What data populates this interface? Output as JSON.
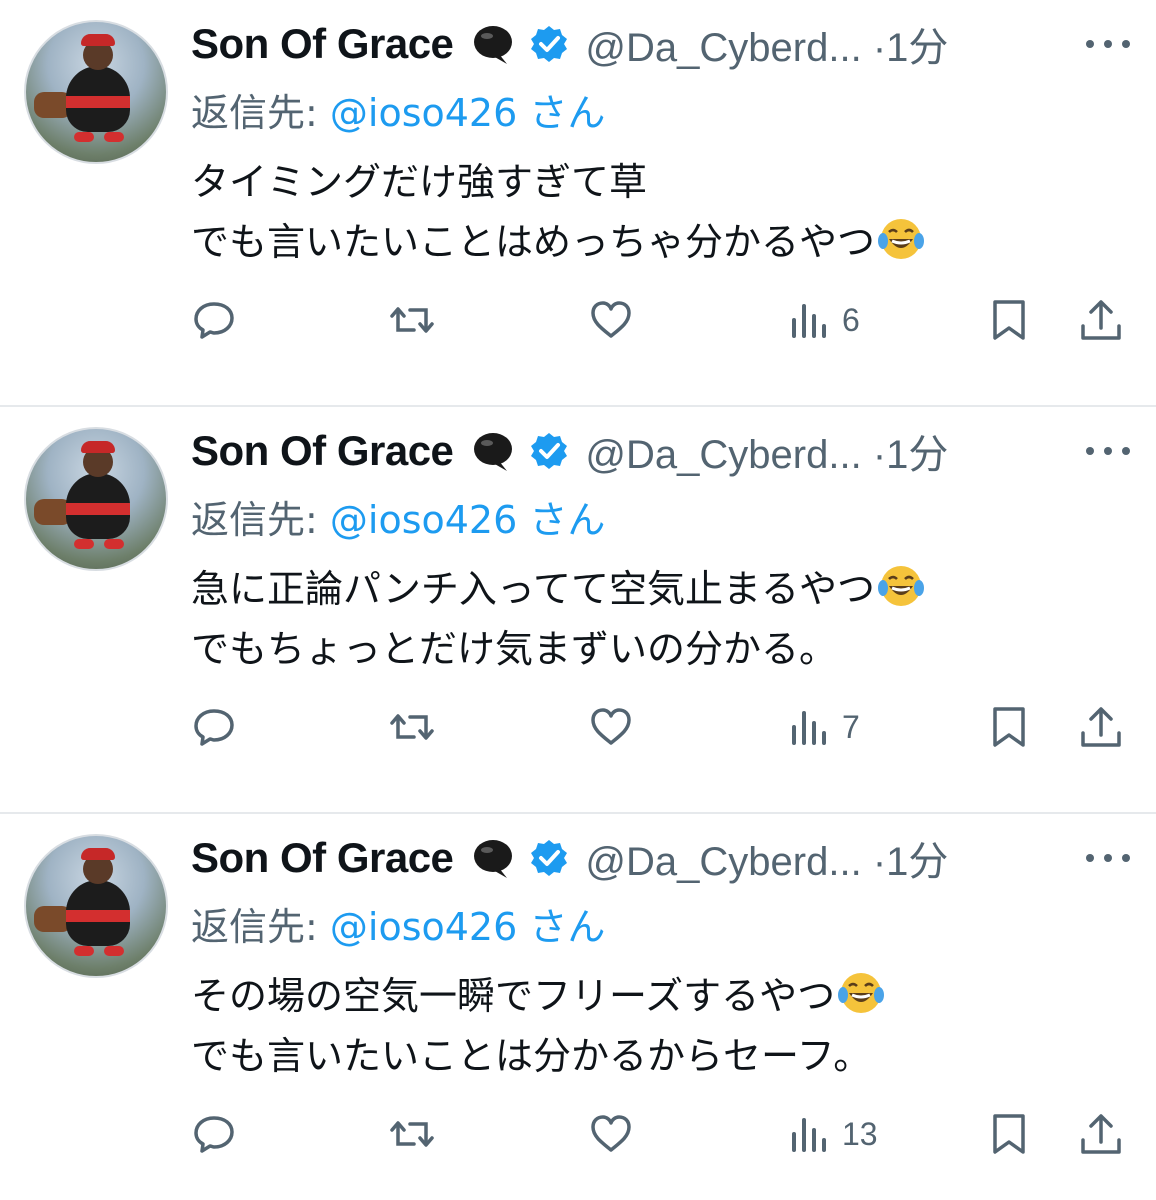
{
  "tweets": [
    {
      "author": "Son Of Grace",
      "handle": "@Da_Cyberd...",
      "time": "1分",
      "reply_label": "返信先:",
      "reply_to": "@ioso426 さん",
      "lines": [
        "タイミングだけ強すぎて草",
        "でも言いたいことはめっちゃ分かるやつ"
      ],
      "emoji_line": 1,
      "views": "6"
    },
    {
      "author": "Son Of Grace",
      "handle": "@Da_Cyberd...",
      "time": "1分",
      "reply_label": "返信先:",
      "reply_to": "@ioso426 さん",
      "lines": [
        "急に正論パンチ入ってて空気止まるやつ",
        "でもちょっとだけ気まずいの分かる。"
      ],
      "emoji_line": 0,
      "views": "7"
    },
    {
      "author": "Son Of Grace",
      "handle": "@Da_Cyberd...",
      "time": "1分",
      "reply_label": "返信先:",
      "reply_to": "@ioso426 さん",
      "lines": [
        "その場の空気一瞬でフリーズするやつ",
        "でも言いたいことは分かるからセーフ。"
      ],
      "emoji_line": 0,
      "views": "13"
    }
  ],
  "separator": "·",
  "emoji": "face-with-tears-of-joy",
  "icons": [
    "reply-icon",
    "retweet-icon",
    "like-icon",
    "views-icon",
    "bookmark-icon",
    "share-icon"
  ],
  "colors": {
    "verified": "#1d9bf0",
    "muted": "#536471",
    "mention": "#1d9bf0",
    "text": "#0f1419"
  }
}
